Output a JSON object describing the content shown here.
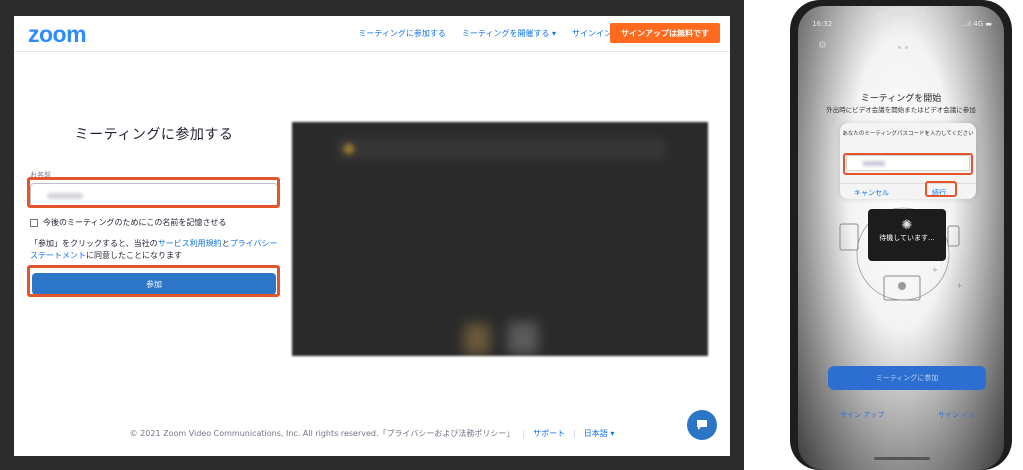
{
  "browser": {
    "logo": "zoom",
    "nav": {
      "join": "ミーティングに参加する",
      "host": "ミーティングを開催する ▾",
      "signin": "サインイン",
      "signup": "サインアップは無料です"
    },
    "form": {
      "title": "ミーティングに参加する",
      "name_label": "お名前",
      "remember_label": "今後のミーティングのためにこの名前を記憶させる",
      "terms_prefix": "「参加」をクリックすると、当社の",
      "terms_link1": "サービス利用規約",
      "terms_and": "と",
      "terms_link2": "プライバシーステートメント",
      "terms_suffix": "に同意したことになります",
      "join_button": "参加"
    },
    "footer": {
      "copyright": "© 2021 Zoom Video Communications, Inc. All rights reserved.「プライバシーおよび法務ポリシー」",
      "support": "サポート",
      "language": "日本語 ▾"
    }
  },
  "phone": {
    "status_time": "16:32",
    "status_icons": "..ıl 4G ▬",
    "title": "ミーティングを開始",
    "subtitle": "外出時にビデオ会議を開始またはビデオ会議に参加",
    "dialog": {
      "message": "あなたのミーティングパスコードを入力してください",
      "cancel": "キャンセル",
      "continue": "続行"
    },
    "waiting": "待機しています...",
    "join_button": "ミーティングに参加",
    "sign_up": "サイン アップ",
    "sign_in": "サイン イン"
  },
  "colors": {
    "highlight": "#e3552c",
    "zoom_blue": "#2d8cff",
    "signup_orange": "#ff6a1f"
  }
}
